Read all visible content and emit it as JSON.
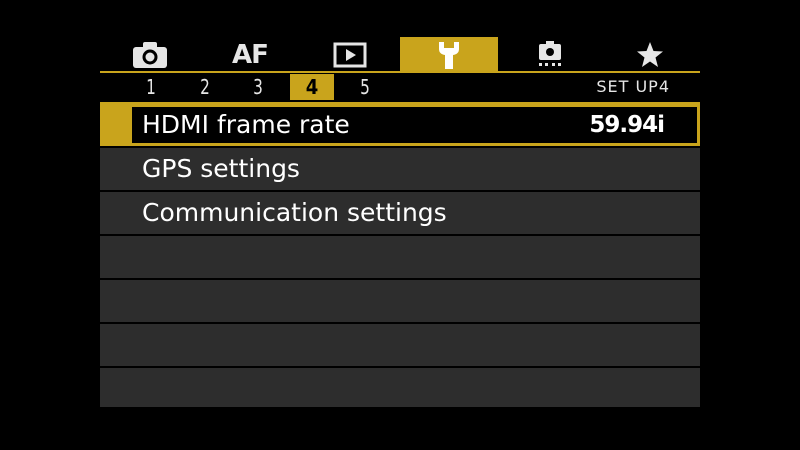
{
  "tabs": [
    {
      "id": "shooting",
      "icon": "camera-icon",
      "label": ""
    },
    {
      "id": "af",
      "icon": "",
      "label": "AF"
    },
    {
      "id": "playback",
      "icon": "playback-icon",
      "label": ""
    },
    {
      "id": "setup",
      "icon": "wrench-icon",
      "label": "",
      "active": true
    },
    {
      "id": "custom-functions",
      "icon": "custom-functions-icon",
      "label": ""
    },
    {
      "id": "my-menu",
      "icon": "star-icon",
      "label": ""
    }
  ],
  "pages": [
    "1",
    "2",
    "3",
    "4",
    "5"
  ],
  "active_page": "4",
  "section_label": "SET UP4",
  "menu": {
    "items": [
      {
        "label": "HDMI frame rate",
        "value": "59.94i",
        "selected": true
      },
      {
        "label": "GPS settings",
        "value": ""
      },
      {
        "label": "Communication settings",
        "value": ""
      },
      {
        "label": "",
        "value": ""
      },
      {
        "label": "",
        "value": ""
      },
      {
        "label": "",
        "value": ""
      },
      {
        "label": "",
        "value": ""
      }
    ]
  },
  "colors": {
    "accent": "#c9a41c",
    "row_bg": "#2d2d2d",
    "background": "#000000",
    "text": "#ffffff"
  }
}
